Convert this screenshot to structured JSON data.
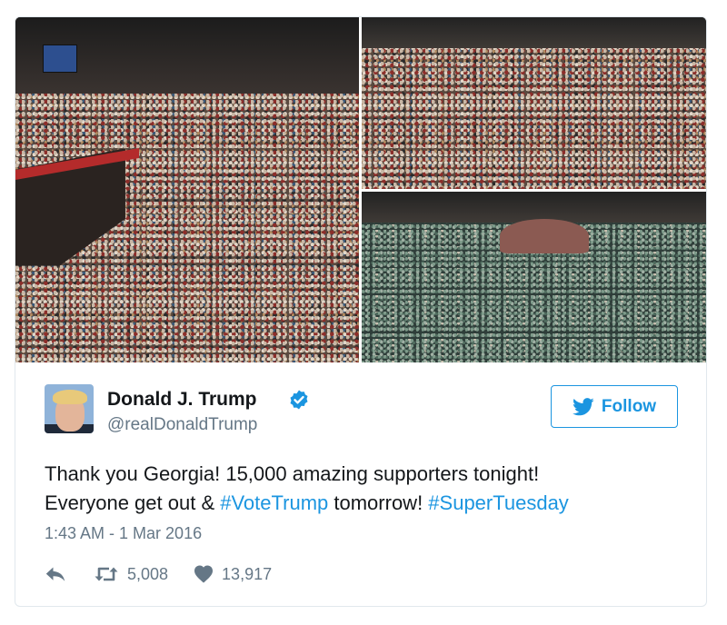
{
  "tweet": {
    "author_name": "Donald J. Trump",
    "handle": "@realDonaldTrump",
    "verified": true,
    "follow_label": "Follow",
    "text_line1": "Thank you Georgia! 15,000 amazing supporters tonight!",
    "text_line2_prefix": "Everyone get out & ",
    "hashtag1": "#VoteTrump",
    "text_line2_middle": " tomorrow! ",
    "hashtag2": "#SuperTuesday",
    "timestamp": "1:43 AM - 1 Mar 2016",
    "retweet_count": "5,008",
    "like_count": "13,917"
  },
  "icons": {
    "reply": "reply-icon",
    "retweet": "retweet-icon",
    "like": "heart-icon",
    "verified": "verified-badge-icon",
    "follow": "twitter-bird-icon"
  },
  "colors": {
    "accent": "#1b95e0",
    "secondary_text": "#657786",
    "primary_text": "#14171a",
    "border": "#e1e8ed"
  }
}
